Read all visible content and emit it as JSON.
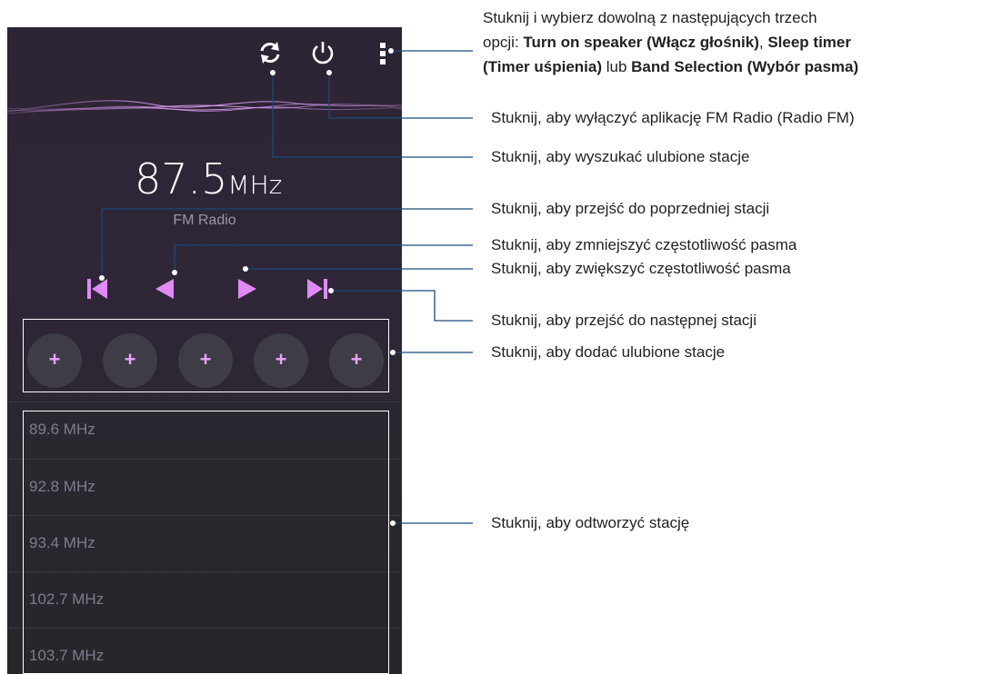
{
  "app": {
    "frequency_value": "87.5",
    "frequency_unit": "MHz",
    "station_name": "FM Radio",
    "favorites": [
      "+",
      "+",
      "+",
      "+",
      "+"
    ],
    "stations": [
      "89.6 MHz",
      "92.8 MHz",
      "93.4 MHz",
      "102.7 MHz",
      "103.7 MHz"
    ]
  },
  "icons": {
    "refresh": "refresh-icon",
    "power": "power-icon",
    "menu": "more-vert-icon",
    "prev_station": "skip-previous-icon",
    "decrease": "step-back-icon",
    "increase": "step-forward-icon",
    "next_station": "skip-next-icon"
  },
  "colors": {
    "accent": "#e08af5",
    "bg_top": "#2c2433",
    "bg_bottom": "#27262a",
    "callout_line": "#1a4a7a"
  },
  "annotations": {
    "menu_line1": "Stuknij i wybierz dowolną z następujących trzech",
    "menu_line2_prefix": "opcji: ",
    "menu_opt1": "Turn on speaker (Włącz głośnik)",
    "menu_sep1": ", ",
    "menu_opt2": "Sleep timer",
    "menu_opt2b": "(Timer uśpienia)",
    "menu_sep2": " lub ",
    "menu_opt3": "Band Selection (Wybór pasma)",
    "power": "Stuknij, aby wyłączyć aplikację FM Radio (Radio FM)",
    "search": "Stuknij, aby wyszukać ulubione stacje",
    "prev": "Stuknij, aby przejść do poprzedniej stacji",
    "decrease": "Stuknij, aby zmniejszyć częstotliwość pasma",
    "increase": "Stuknij, aby zwiększyć częstotliwość pasma",
    "next": "Stuknij, aby przejść do następnej stacji",
    "add_fav": "Stuknij, aby dodać ulubione stacje",
    "play": "Stuknij, aby odtworzyć stację"
  }
}
